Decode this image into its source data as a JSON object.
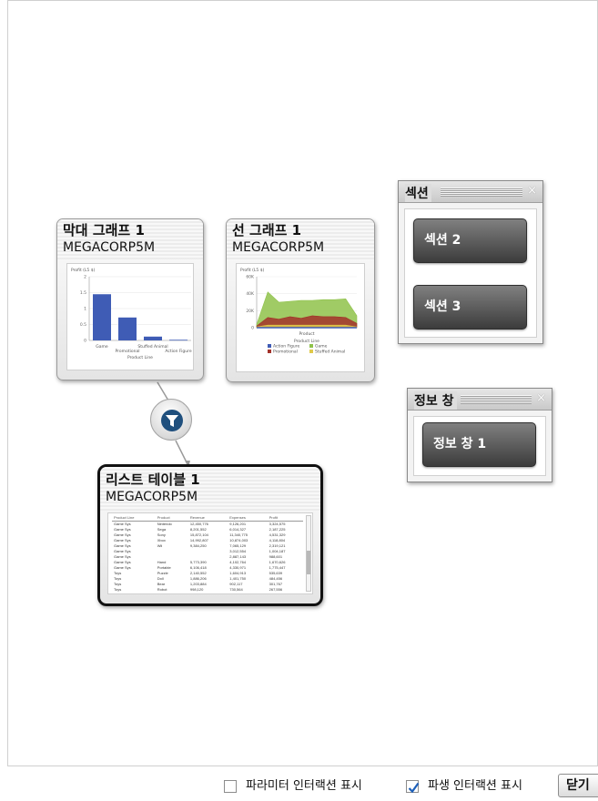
{
  "cards": {
    "bar": {
      "title": "막대 그래프 1",
      "subtitle": "MEGACORP5M",
      "chart_data": {
        "type": "bar",
        "title": "",
        "ylabel": "Profit (L5 $)",
        "xlabel": "Product Line",
        "y_ticks": [
          "2",
          "1.5",
          "1",
          "0.5",
          "0"
        ],
        "categories": [
          "Game",
          "Promotional",
          "Stuffed Animal",
          "Action Figure"
        ],
        "values": [
          1.45,
          0.72,
          0.12,
          0.02
        ],
        "ylim": [
          0,
          2
        ],
        "color": "#3f5cb5"
      }
    },
    "line": {
      "title": "선 그래프 1",
      "subtitle": "MEGACORP5M",
      "chart_data": {
        "type": "area",
        "ylabel": "Profit (L5 $)",
        "xlabel": "Product",
        "y_ticks": [
          "60K",
          "40K",
          "20K",
          "0"
        ],
        "legend_title": "Product Line",
        "legend_placement": "bottom",
        "ylim": [
          0,
          60
        ],
        "series": [
          {
            "name": "Action Figure",
            "color": "#3f5cb5",
            "values": [
              0,
              0,
              0,
              0,
              0,
              0,
              0,
              0,
              0,
              0
            ]
          },
          {
            "name": "Game",
            "color": "#8fc24a",
            "values": [
              4,
              42,
              30,
              31,
              32,
              32,
              33,
              33,
              34,
              14
            ]
          },
          {
            "name": "Promotional",
            "color": "#a3322a",
            "values": [
              2,
              12,
              10,
              13,
              11,
              14,
              13,
              13,
              12,
              5
            ]
          },
          {
            "name": "Stuffed Animal",
            "color": "#e0c94a",
            "values": [
              1,
              3,
              3,
              3,
              3,
              3,
              3,
              3,
              3,
              1
            ]
          }
        ]
      }
    },
    "list": {
      "title": "리스트 테이블 1",
      "subtitle": "MEGACORP5M",
      "columns": [
        "Product Line",
        "Product",
        "Revenue",
        "Expenses",
        "Profit"
      ],
      "rows": [
        [
          "Game Sys",
          "Nintendo",
          "12,450,776",
          "9,126,201",
          "3,324,575"
        ],
        [
          "Game Sys",
          "Sega",
          "8,201,552",
          "6,014,327",
          "2,187,225"
        ],
        [
          "Game Sys",
          "Sony",
          "15,872,104",
          "11,340,775",
          "4,531,329"
        ],
        [
          "Game Sys",
          "Xbox",
          "14,992,807",
          "10,874,003",
          "4,118,804"
        ],
        [
          "Game Sys",
          "Wii",
          "9,384,250",
          "7,065,129",
          "2,319,121"
        ],
        [
          "Game Sys",
          "",
          "",
          "3,012,554",
          "1,004,187"
        ],
        [
          "Game Sys",
          "",
          "",
          "2,887,143",
          "988,601"
        ],
        [
          "Game Sys",
          "Hand",
          "5,773,390",
          "4,102,764",
          "1,670,626"
        ],
        [
          "Game Sys",
          "Portable",
          "6,106,418",
          "4,330,971",
          "1,775,447"
        ],
        [
          "Toys",
          "Puzzle",
          "2,140,552",
          "1,604,913",
          "535,639"
        ],
        [
          "Toys",
          "Doll",
          "1,886,206",
          "1,401,750",
          "484,456"
        ],
        [
          "Toys",
          "Bear",
          "1,203,884",
          "902,117",
          "301,767"
        ],
        [
          "Toys",
          "Robot",
          "998,120",
          "730,564",
          "267,556"
        ]
      ]
    }
  },
  "sections_panel": {
    "title": "섹션",
    "close_glyph": "×",
    "buttons": [
      "섹션 2",
      "섹션 3"
    ]
  },
  "info_panel": {
    "title": "정보 창",
    "close_glyph": "×",
    "buttons": [
      "정보 창 1"
    ]
  },
  "footer": {
    "param_interaction_label": "파라미터 인터랙션 표시",
    "param_interaction_checked": false,
    "derived_interaction_label": "파생 인터랙션 표시",
    "derived_interaction_checked": true,
    "close_label": "닫기"
  }
}
